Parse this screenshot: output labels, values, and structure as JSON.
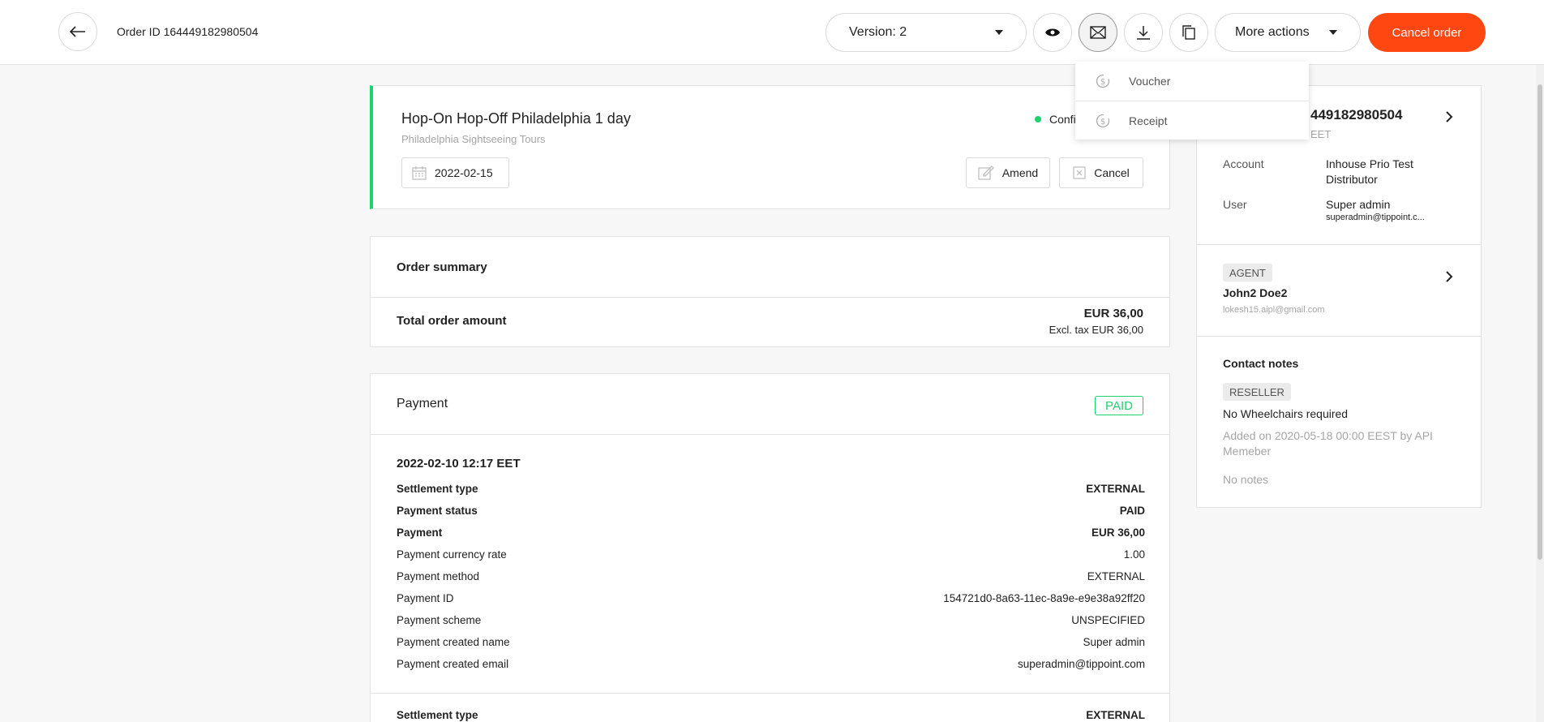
{
  "header": {
    "order_id": "Order ID 164449182980504",
    "version": "Version: 2",
    "more_actions": "More actions",
    "cancel_order": "Cancel order"
  },
  "dropdown": {
    "items": [
      {
        "label": "Voucher",
        "icon": "voucher-icon"
      },
      {
        "label": "Receipt",
        "icon": "receipt-icon"
      }
    ]
  },
  "product": {
    "title": "Hop-On Hop-Off Philadelphia 1 day",
    "subtitle": "Philadelphia Sightseeing Tours",
    "status": "Confir",
    "date": "2022-02-15",
    "amend": "Amend",
    "cancel": "Cancel"
  },
  "summary": {
    "heading": "Order summary",
    "total_label": "Total order amount",
    "total_amount": "EUR 36,00",
    "excl_tax": "Excl. tax EUR 36,00"
  },
  "payment": {
    "heading": "Payment",
    "badge": "PAID",
    "date": "2022-02-10 12:17 EET",
    "rows": [
      {
        "label": "Settlement type",
        "value": "EXTERNAL",
        "bold": true
      },
      {
        "label": "Payment status",
        "value": "PAID",
        "bold": true
      },
      {
        "label": "Payment",
        "value": "EUR 36,00",
        "bold": true
      },
      {
        "label": "Payment currency rate",
        "value": "1.00",
        "bold": false
      },
      {
        "label": "Payment method",
        "value": "EXTERNAL",
        "bold": false
      },
      {
        "label": "Payment ID",
        "value": "154721d0-8a63-11ec-8a9e-e9e38a92ff20",
        "bold": false
      },
      {
        "label": "Payment scheme",
        "value": "UNSPECIFIED",
        "bold": false
      },
      {
        "label": "Payment created name",
        "value": "Super admin",
        "bold": false
      },
      {
        "label": "Payment created email",
        "value": "superadmin@tippoint.com",
        "bold": false
      }
    ],
    "second_row": {
      "label": "Settlement type",
      "value": "EXTERNAL"
    }
  },
  "side": {
    "order_id_partial": "449182980504",
    "timezone_partial": "EET",
    "account_label": "Account",
    "account_value": "Inhouse Prio Test Distributor",
    "user_label": "User",
    "user_value": "Super admin",
    "user_email": "superadmin@tippoint.c...",
    "agent_tag": "AGENT",
    "agent_name": "John2 Doe2",
    "agent_email": "lokesh15.aipl@gmail.com",
    "contact_heading": "Contact notes",
    "reseller_tag": "RESELLER",
    "note": "No Wheelchairs required",
    "note_meta": "Added on 2020-05-18 00:00 EEST by API Memeber",
    "no_notes": "No notes"
  },
  "colors": {
    "accent": "#ff4712",
    "success": "#1dd26e"
  }
}
